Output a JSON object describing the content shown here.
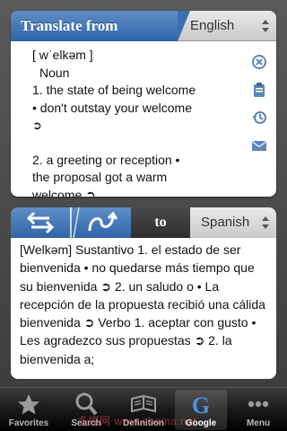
{
  "source": {
    "header_label": "Translate from",
    "language": "English",
    "lines": [
      "[ wˈelkəm ]",
      "Noun",
      "1.    the state of being welcome",
      "• don't outstay your welcome",
      "➲",
      "2.    a greeting or reception  •",
      "the proposal got a warm",
      "welcome  ➲"
    ],
    "tools": [
      "clear-icon",
      "clipboard-icon",
      "history-icon",
      "mail-icon"
    ]
  },
  "middle": {
    "swap_icon": "swap-arrows-icon",
    "translit_icon": "transliterate-icon",
    "to_label": "to",
    "target_language": "Spanish"
  },
  "result": {
    "text": "[Welkəm] Sustantivo 1. el estado de ser bienvenida • no quedarse más tiempo que su bienvenida ➲ 2. un saludo o • La recepción de la propuesta recibió una cálida bienvenida ➲ Verbo 1. aceptar con gusto • Les agradezco sus propuestas ➲ 2. la bienvenida a;"
  },
  "tabs": [
    {
      "label": "Favorites",
      "icon": "star-icon"
    },
    {
      "label": "Search",
      "icon": "magnifier-icon"
    },
    {
      "label": "Definition",
      "icon": "book-icon"
    },
    {
      "label": "Google",
      "icon": "google-g-icon",
      "glyph": "G"
    },
    {
      "label": "Menu",
      "icon": "more-dots-icon"
    }
  ],
  "active_tab": "Google",
  "colors": {
    "accent_blue": "#2f64a8",
    "panel_bg": "#ffffff",
    "background": "#4a4a4a",
    "icon_blue": "#5a86b8"
  },
  "watermark": "多媒网 www.ebama.net"
}
